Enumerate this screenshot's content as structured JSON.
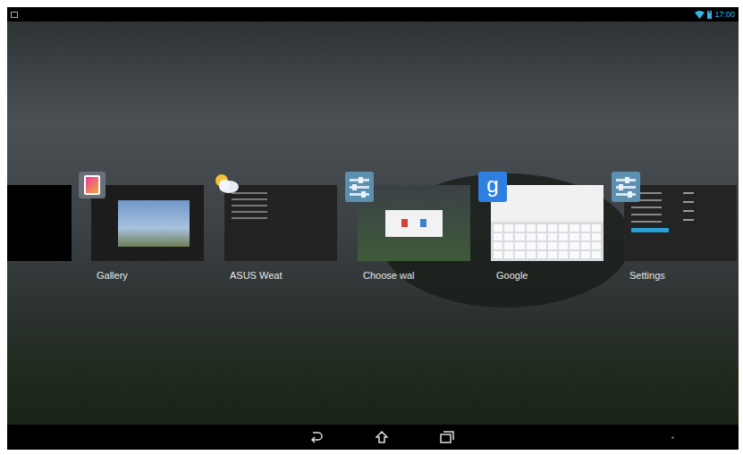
{
  "status_bar": {
    "time": "17:00",
    "wifi": true,
    "battery_level": 0.8
  },
  "recent_apps": [
    {
      "label": "Gallery",
      "kind": "gallery"
    },
    {
      "label": "ASUS Weat",
      "kind": "weather"
    },
    {
      "label": "Choose wal",
      "kind": "wallpaper"
    },
    {
      "label": "Google",
      "kind": "google",
      "icon_text": "g"
    },
    {
      "label": "Settings",
      "kind": "settings"
    }
  ]
}
